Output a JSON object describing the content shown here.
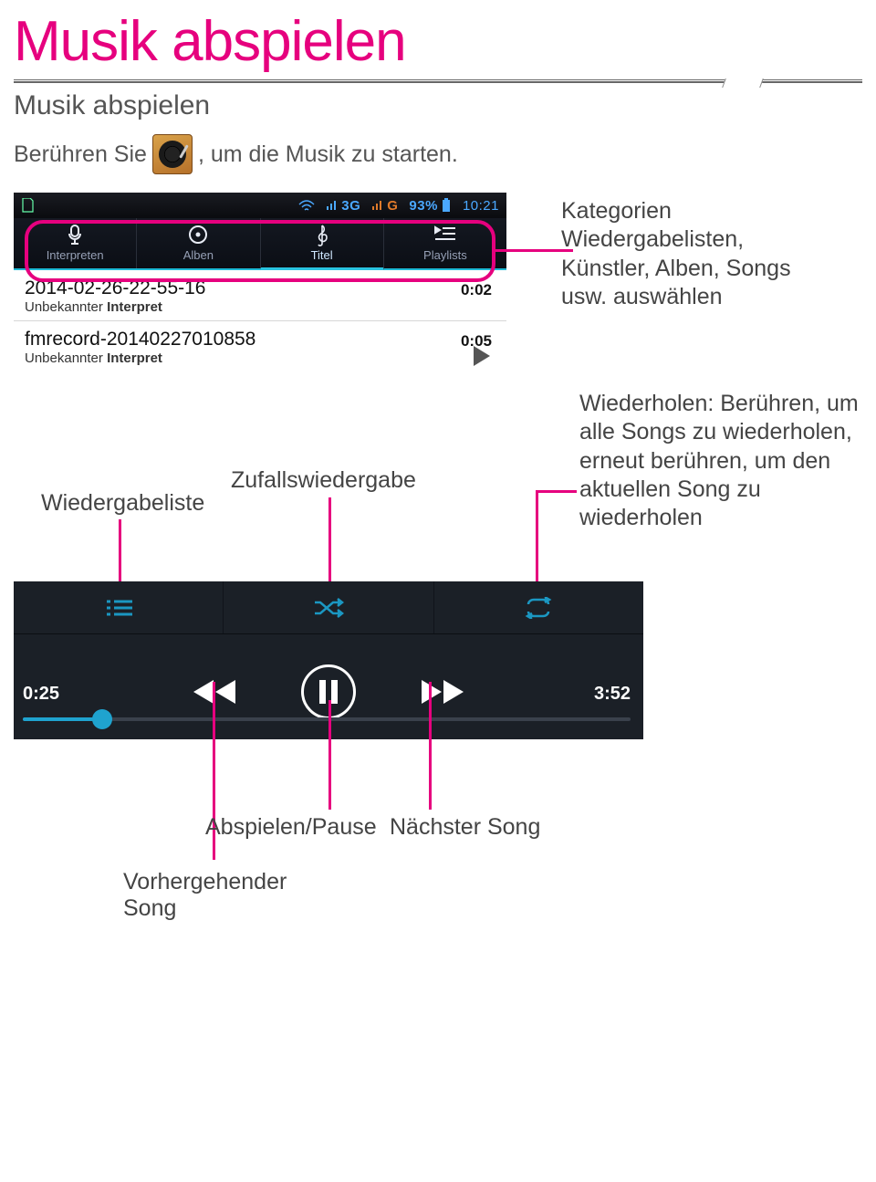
{
  "page": {
    "title": "Musik abspielen",
    "subtitle": "Musik abspielen",
    "intro_before": "Berühren Sie",
    "intro_after": ", um die Musik zu starten."
  },
  "callouts": {
    "categories": "Kategorien Wiedergabelisten, Künstler, Alben, Songs usw. auswählen",
    "playlist": "Wiedergabeliste",
    "shuffle": "Zufallswiedergabe",
    "repeat": "Wiederholen: Berühren, um alle Songs zu wiederholen, erneut berühren, um den aktuellen Song zu wiederholen",
    "prev": "Vorhergehender Song",
    "playpause": "Abspielen/Pause",
    "next": "Nächster Song"
  },
  "statusbar": {
    "net1": "3G",
    "net2": "G",
    "battery": "93%",
    "clock": "10:21"
  },
  "tabs": {
    "artists": "Interpreten",
    "albums": "Alben",
    "titles": "Titel",
    "playlists": "Playlists"
  },
  "tracks": [
    {
      "title": "2014-02-26-22-55-16",
      "artist_label": "Unbekannter",
      "artist_bold": "Interpret",
      "duration": "0:02"
    },
    {
      "title": "fmrecord-20140227010858",
      "artist_label": "Unbekannter",
      "artist_bold": "Interpret",
      "duration": "0:05"
    }
  ],
  "player": {
    "elapsed": "0:25",
    "total": "3:52"
  }
}
